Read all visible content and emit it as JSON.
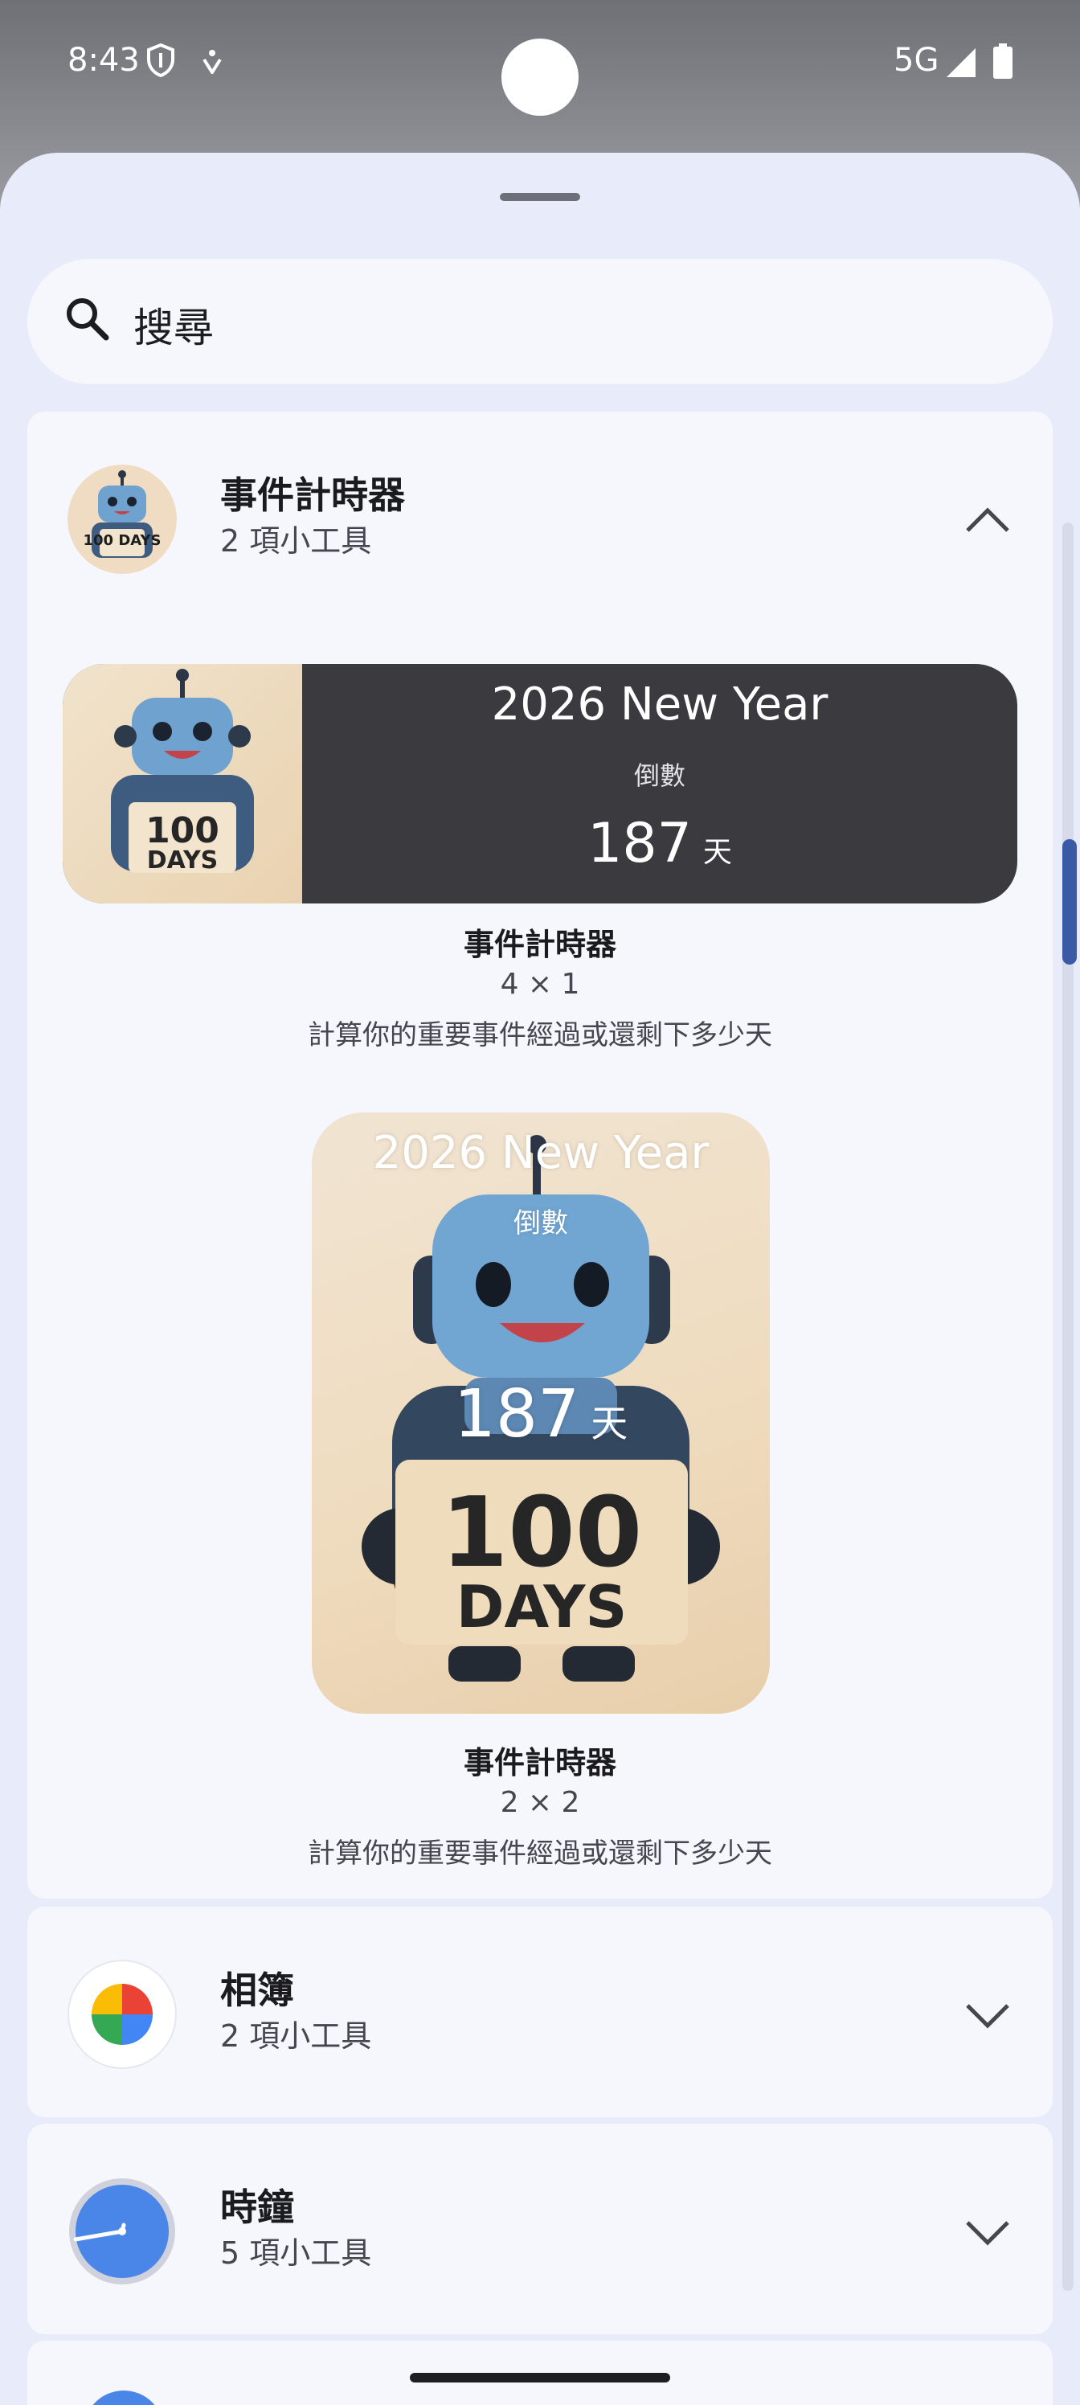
{
  "status": {
    "time": "8:43",
    "network": "5G"
  },
  "search": {
    "label": "搜尋"
  },
  "sections": [
    {
      "title": "事件計時器",
      "subtitle": "2 項小工具",
      "expanded": true
    },
    {
      "title": "相簿",
      "subtitle": "2 項小工具",
      "expanded": false
    },
    {
      "title": "時鐘",
      "subtitle": "5 項小工具",
      "expanded": false
    }
  ],
  "widgets": [
    {
      "preview": {
        "title": "2026 New Year",
        "label": "倒數",
        "count": "187",
        "unit": "天",
        "sign": "100 DAYS"
      },
      "name": "事件計時器",
      "size": "4 × 1",
      "description": "計算你的重要事件經過或還剩下多少天"
    },
    {
      "preview": {
        "title": "2026 New Year",
        "label": "倒數",
        "count": "187",
        "unit": "天",
        "sign": "100 DAYS"
      },
      "name": "事件計時器",
      "size": "2 × 2",
      "description": "計算你的重要事件經過或還剩下多少天"
    }
  ],
  "colors": {
    "sheet": "#e8ebf9",
    "card": "#f6f7fd",
    "wide_widget": "#3a3a3f",
    "accent": "#3a5aa6"
  }
}
